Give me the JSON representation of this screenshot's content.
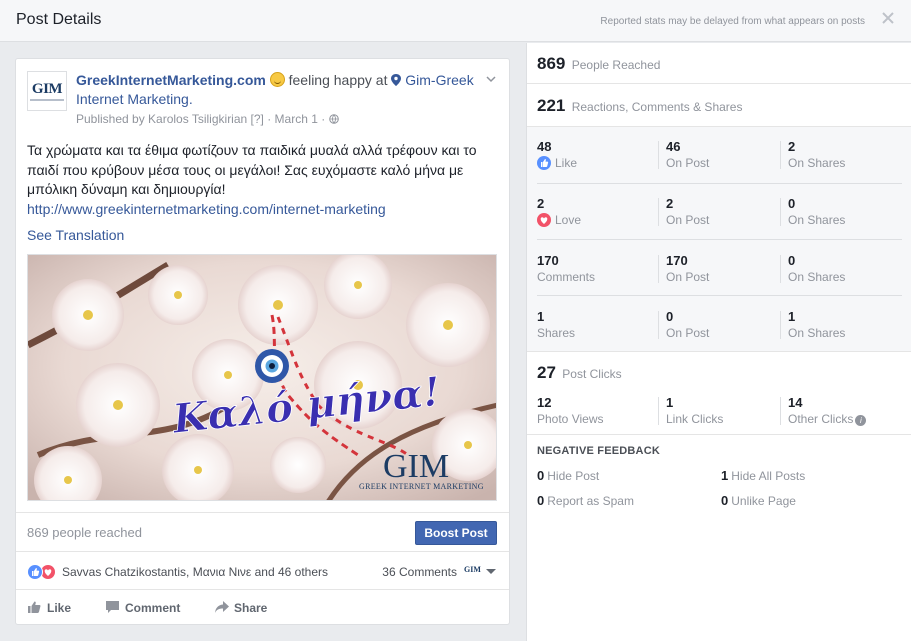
{
  "header": {
    "title": "Post Details",
    "note": "Reported stats may be delayed from what appears on posts"
  },
  "post": {
    "logo_text": "GIM",
    "page_name": "GreekInternetMarketing.com",
    "feeling": "feeling happy at",
    "place_line1": "Gim-Greek",
    "place_line2": "Internet Marketing.",
    "meta": "Published by Karolos Tsiligkirian [?] · March 1 · ",
    "body": "Τα χρώματα και τα έθιμα φωτίζουν τα παιδικά μυαλά αλλά τρέφουν και το παιδί που κρύβουν μέσα τους οι μεγάλοι! Σας ευχόμαστε καλό μήνα με μπόλικη δύναμη και δημιουργία!",
    "link": "http://www.greekinternetmarketing.com/internet-marketing",
    "see_translation": "See Translation",
    "image_greeting": "Καλό μήνα!",
    "image_logo": "GIM",
    "image_logo_sub": "GREEK INTERNET MARKETING",
    "reached": "869 people reached",
    "boost_label": "Boost Post",
    "reactors": "Savvas Chatzikostantis, Μανια Νινε and 46 others",
    "comments_count": "36 Comments",
    "mini_logo": "GIM",
    "actions": {
      "like": "Like",
      "comment": "Comment",
      "share": "Share"
    }
  },
  "stats": {
    "reached": {
      "value": "869",
      "label": "People Reached"
    },
    "engagement": {
      "value": "221",
      "label": "Reactions, Comments & Shares"
    },
    "rows": [
      {
        "total": "48",
        "total_label": "Like",
        "on_post": "46",
        "on_post_label": "On Post",
        "on_shares": "2",
        "on_shares_label": "On Shares"
      },
      {
        "total": "2",
        "total_label": "Love",
        "on_post": "2",
        "on_post_label": "On Post",
        "on_shares": "0",
        "on_shares_label": "On Shares"
      },
      {
        "total": "170",
        "total_label": "Comments",
        "on_post": "170",
        "on_post_label": "On Post",
        "on_shares": "0",
        "on_shares_label": "On Shares"
      },
      {
        "total": "1",
        "total_label": "Shares",
        "on_post": "0",
        "on_post_label": "On Post",
        "on_shares": "1",
        "on_shares_label": "On Shares"
      }
    ],
    "clicks": {
      "value": "27",
      "label": "Post Clicks",
      "items": [
        {
          "value": "12",
          "label": "Photo Views"
        },
        {
          "value": "1",
          "label": "Link Clicks"
        },
        {
          "value": "14",
          "label": "Other Clicks"
        }
      ]
    },
    "negative": {
      "title": "NEGATIVE FEEDBACK",
      "items": [
        {
          "value": "0",
          "label": "Hide Post"
        },
        {
          "value": "1",
          "label": "Hide All Posts"
        },
        {
          "value": "0",
          "label": "Report as Spam"
        },
        {
          "value": "0",
          "label": "Unlike Page"
        }
      ]
    }
  },
  "colors": {
    "link": "#365899",
    "boost": "#4267b2",
    "like": "#5890ff",
    "love": "#f25268"
  }
}
